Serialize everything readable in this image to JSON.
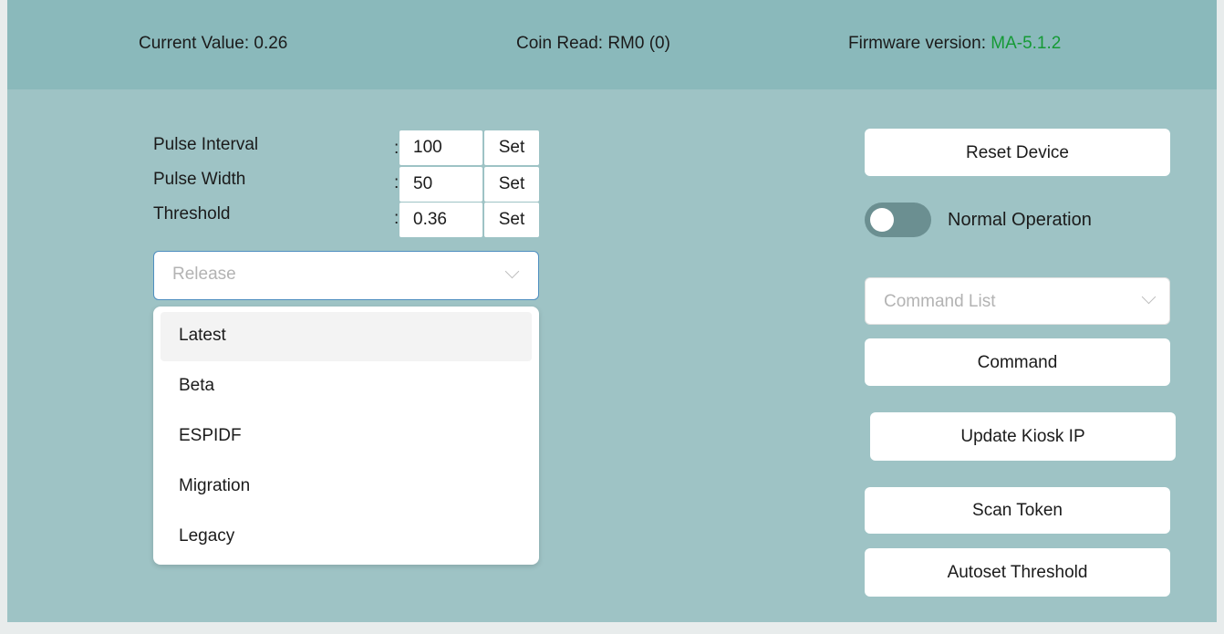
{
  "header": {
    "current_value": "Current Value: 0.26",
    "coin_read": "Coin Read: RM0 (0)",
    "firmware_label": "Firmware version: ",
    "firmware_value": "MA-5.1.2"
  },
  "settings": [
    {
      "label": "Pulse Interval",
      "colon": ":",
      "value": "100",
      "button": "Set"
    },
    {
      "label": "Pulse Width",
      "colon": ":",
      "value": "50",
      "button": "Set"
    },
    {
      "label": "Threshold",
      "colon": ":",
      "value": "0.36",
      "button": "Set"
    }
  ],
  "release_select": {
    "placeholder": "Release",
    "expanded": true,
    "options": [
      "Latest",
      "Beta",
      "ESPIDF",
      "Migration",
      "Legacy"
    ],
    "highlighted": "Latest"
  },
  "right_panel": {
    "reset_button": "Reset Device",
    "toggle": {
      "label": "Normal Operation",
      "on": false
    },
    "command_list_placeholder": "Command List",
    "command_button": "Command",
    "update_ip_button": "Update Kiosk IP",
    "scan_token_button": "Scan Token",
    "autoset_button": "Autoset Threshold"
  },
  "colors": {
    "panel_bg": "#9ec3c5",
    "header_bg": "#8ab9bb",
    "firmware_green": "#159a35",
    "toggle_off": "#6b8f91"
  }
}
